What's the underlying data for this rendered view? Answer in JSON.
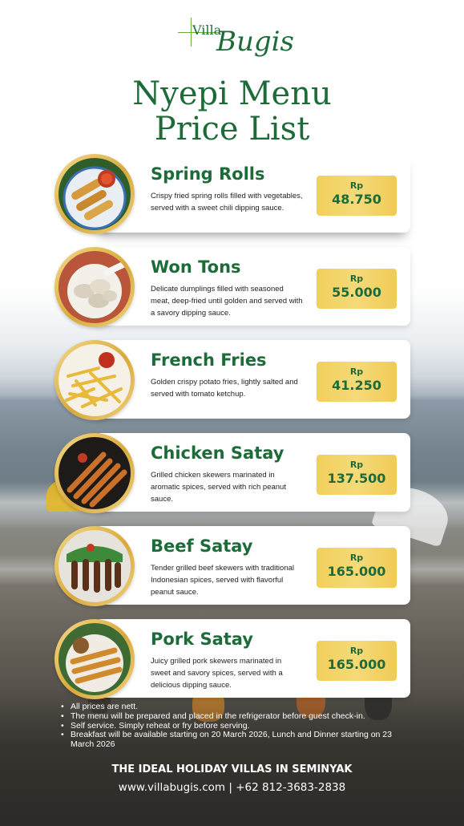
{
  "brand": {
    "logo_small": "Villa",
    "logo_large": "Bugis"
  },
  "title": {
    "line1": "Nyepi Menu",
    "line2": "Price List"
  },
  "items": [
    {
      "name": "Spring Rolls",
      "description": "Crispy fried spring rolls filled with vegetables, served with a sweet chili dipping sauce.",
      "currency": "Rp",
      "price": "48.750",
      "image_icon": "spring-rolls-image"
    },
    {
      "name": "Won Tons",
      "description": "Delicate dumplings filled with seasoned meat, deep-fried until golden and served with a savory dipping sauce.",
      "currency": "Rp",
      "price": "55.000",
      "image_icon": "won-tons-image"
    },
    {
      "name": "French Fries",
      "description": "Golden crispy potato fries, lightly salted and served with tomato ketchup.",
      "currency": "Rp",
      "price": "41.250",
      "image_icon": "french-fries-image"
    },
    {
      "name": "Chicken Satay",
      "description": "Grilled chicken skewers marinated in aromatic spices, served with rich peanut sauce.",
      "currency": "Rp",
      "price": "137.500",
      "image_icon": "chicken-satay-image"
    },
    {
      "name": "Beef Satay",
      "description": "Tender grilled beef skewers with traditional Indonesian spices, served with flavorful peanut sauce.",
      "currency": "Rp",
      "price": "165.000",
      "image_icon": "beef-satay-image"
    },
    {
      "name": "Pork Satay",
      "description": "Juicy grilled pork skewers marinated in sweet and savory spices, served with a delicious dipping sauce.",
      "currency": "Rp",
      "price": "165.000",
      "image_icon": "pork-satay-image"
    }
  ],
  "notes": [
    "All prices are nett.",
    "The menu will be prepared and placed in the refrigerator before guest check-in.",
    "Self service. Simply reheat or fry before serving.",
    "Breakfast will be available starting on 20 March 2026, Lunch and Dinner starting on 23 March 2026"
  ],
  "footer": {
    "tagline": "THE IDEAL HOLIDAY VILLAS IN SEMINYAK",
    "contact": "www.villabugis.com | +62 812-3683-2838"
  },
  "colors": {
    "brand_green": "#1e6b3a",
    "price_gold": "#f2cf5b",
    "plate_gold": "#d8a93c"
  }
}
